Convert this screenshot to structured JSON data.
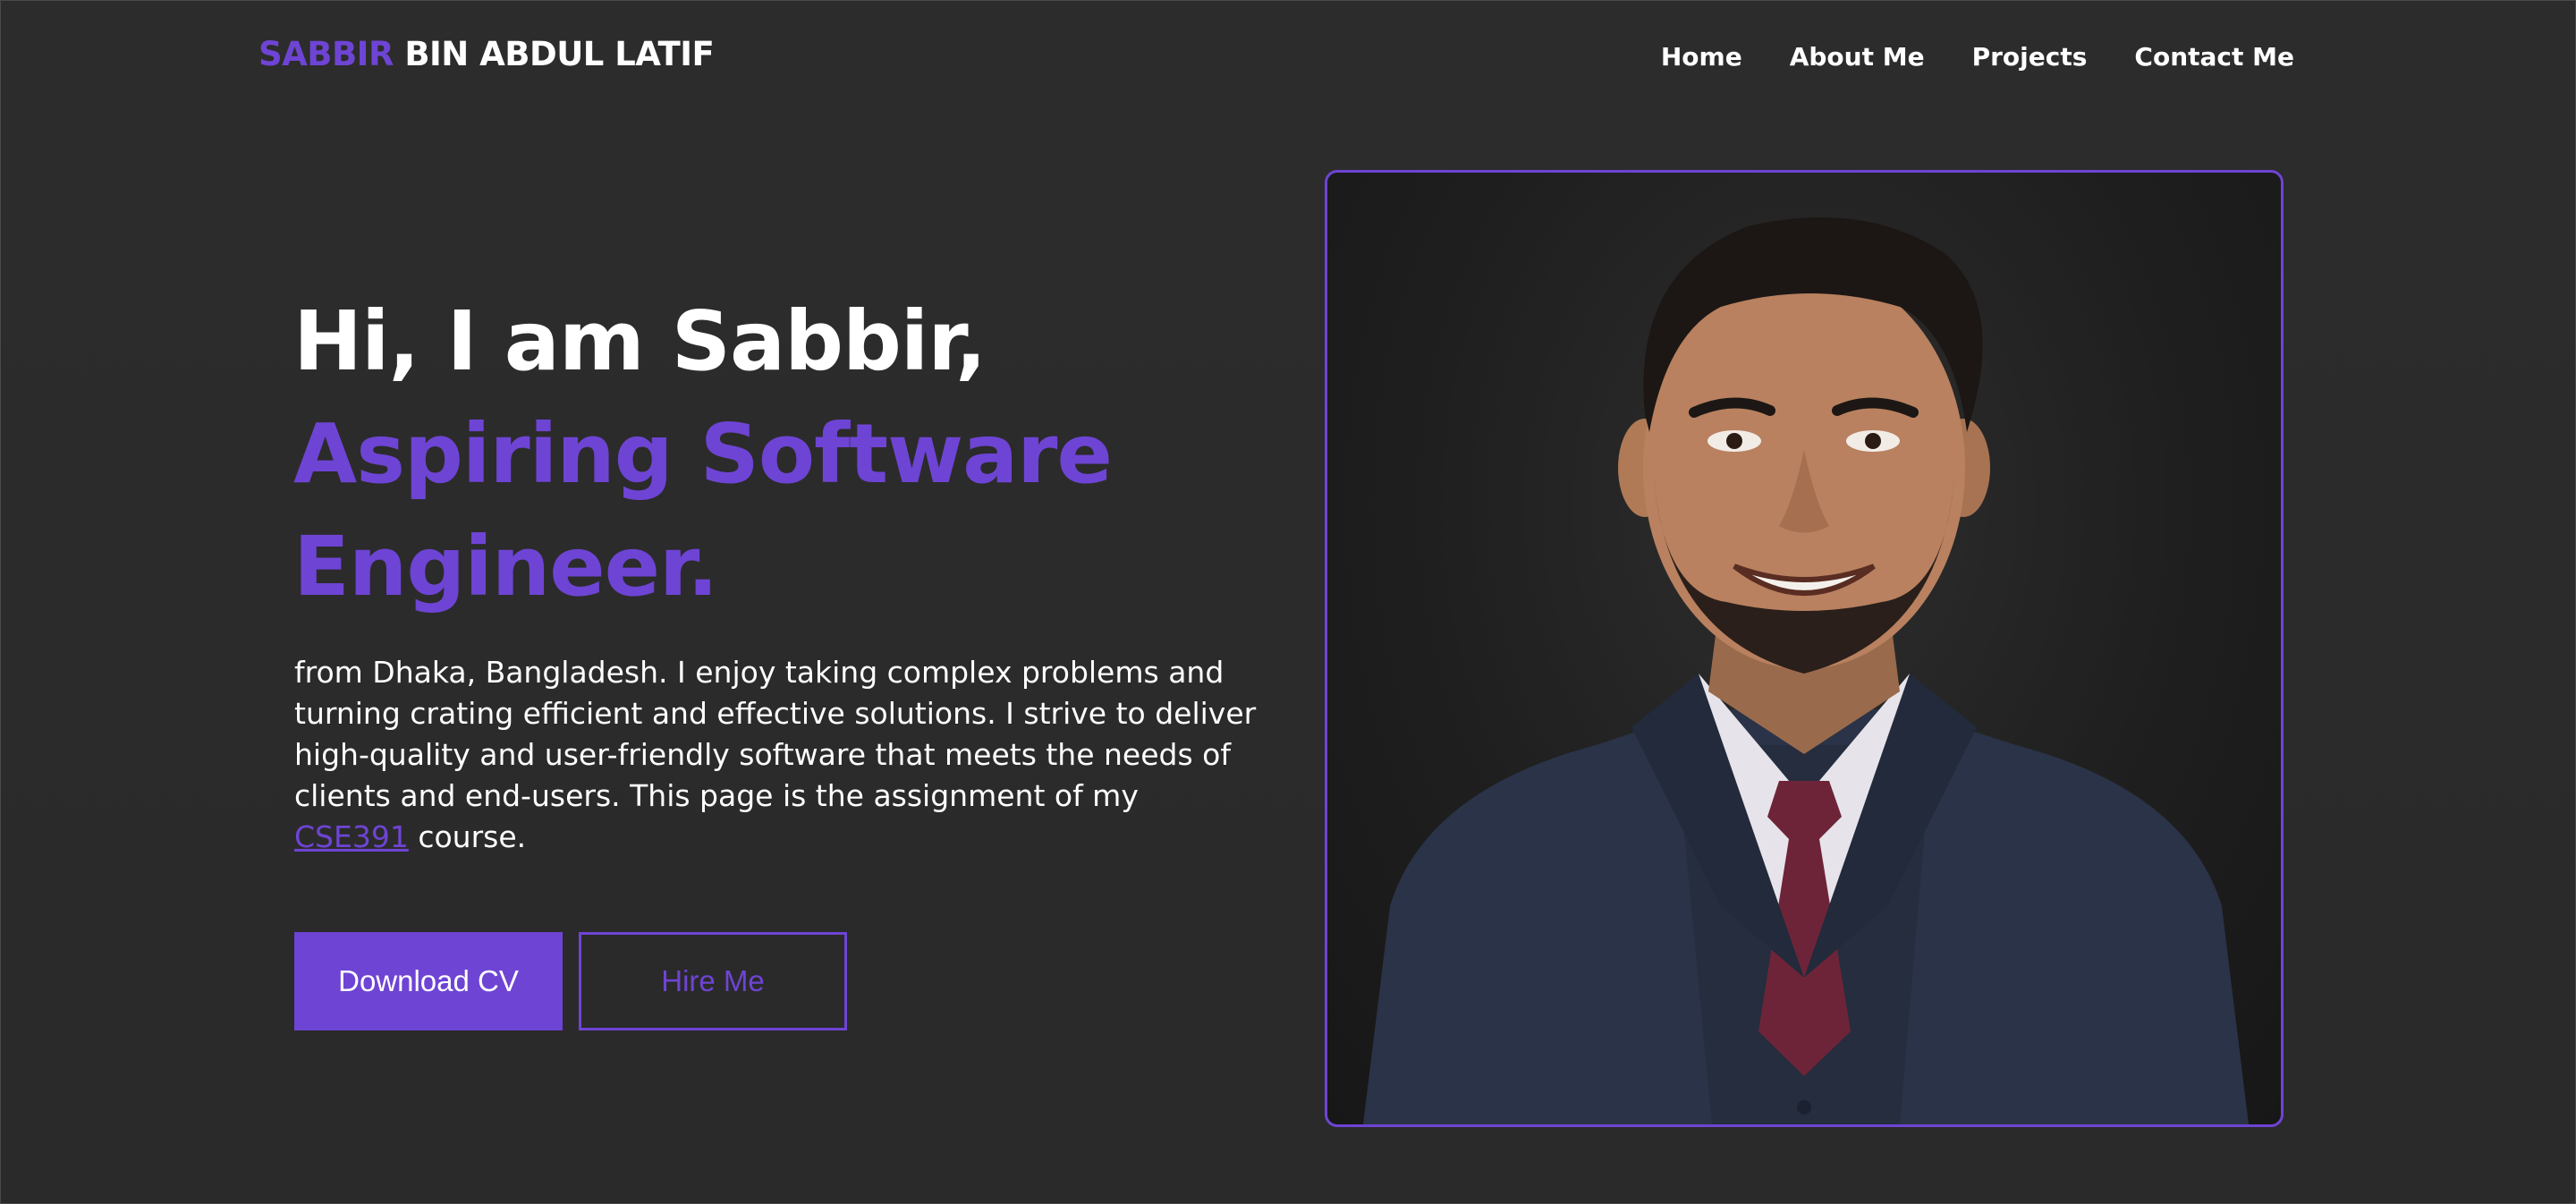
{
  "header": {
    "brand_first": "SABBIR",
    "brand_rest": " BIN ABDUL LATIF",
    "nav": [
      {
        "label": "Home"
      },
      {
        "label": "About Me"
      },
      {
        "label": "Projects"
      },
      {
        "label": "Contact Me"
      }
    ]
  },
  "hero": {
    "greeting": "Hi, I am Sabbir,",
    "role_line1": "Aspiring Software",
    "role_line2": "Engineer.",
    "intro_before": "from Dhaka, Bangladesh. I enjoy taking complex problems and turning crating efficient and effective solutions. I strive to deliver high-quality and user-friendly software that meets the needs of clients and end-users. This page is the assignment of my ",
    "intro_link": "CSE391",
    "intro_after": " course.",
    "download_cv_label": "Download CV",
    "hire_me_label": "Hire Me"
  },
  "portrait": {
    "icon": "profile-photo"
  },
  "colors": {
    "accent": "#6e44d4",
    "background": "#2b2b2b",
    "text": "#ffffff"
  }
}
